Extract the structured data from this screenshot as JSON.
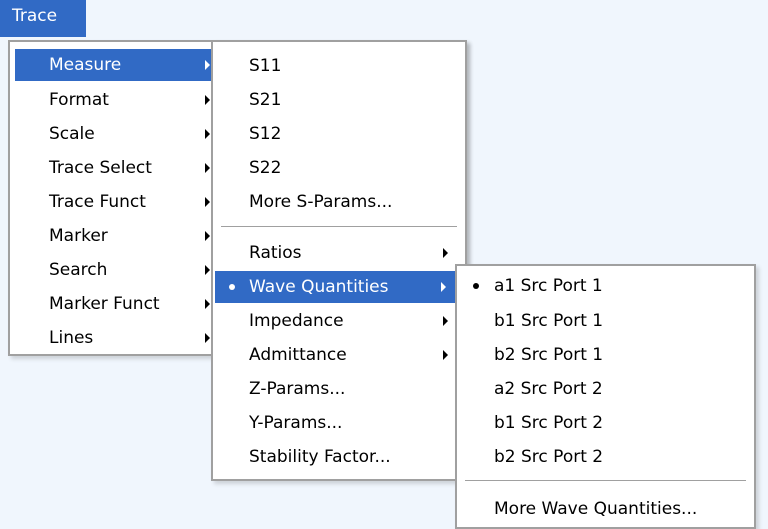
{
  "menubar": {
    "trace_label": "Trace"
  },
  "trace_menu": {
    "items": [
      {
        "label": "Measure"
      },
      {
        "label": "Format"
      },
      {
        "label": "Scale"
      },
      {
        "label": "Trace Select"
      },
      {
        "label": "Trace Funct"
      },
      {
        "label": "Marker"
      },
      {
        "label": "Search"
      },
      {
        "label": "Marker Funct"
      },
      {
        "label": "Lines"
      }
    ]
  },
  "measure_menu": {
    "items": [
      {
        "label": "S11"
      },
      {
        "label": "S21"
      },
      {
        "label": "S12"
      },
      {
        "label": "S22"
      },
      {
        "label": "More S-Params..."
      },
      {
        "label": "Ratios"
      },
      {
        "label": "Wave Quantities"
      },
      {
        "label": "Impedance"
      },
      {
        "label": "Admittance"
      },
      {
        "label": "Z-Params..."
      },
      {
        "label": "Y-Params..."
      },
      {
        "label": "Stability Factor..."
      }
    ]
  },
  "wave_menu": {
    "items": [
      {
        "label": "a1 Src Port 1"
      },
      {
        "label": "b1 Src Port 1"
      },
      {
        "label": "b2 Src Port 1"
      },
      {
        "label": "a2 Src Port 2"
      },
      {
        "label": "b1 Src Port 2"
      },
      {
        "label": "b2 Src Port 2"
      },
      {
        "label": "More Wave Quantities..."
      }
    ]
  }
}
